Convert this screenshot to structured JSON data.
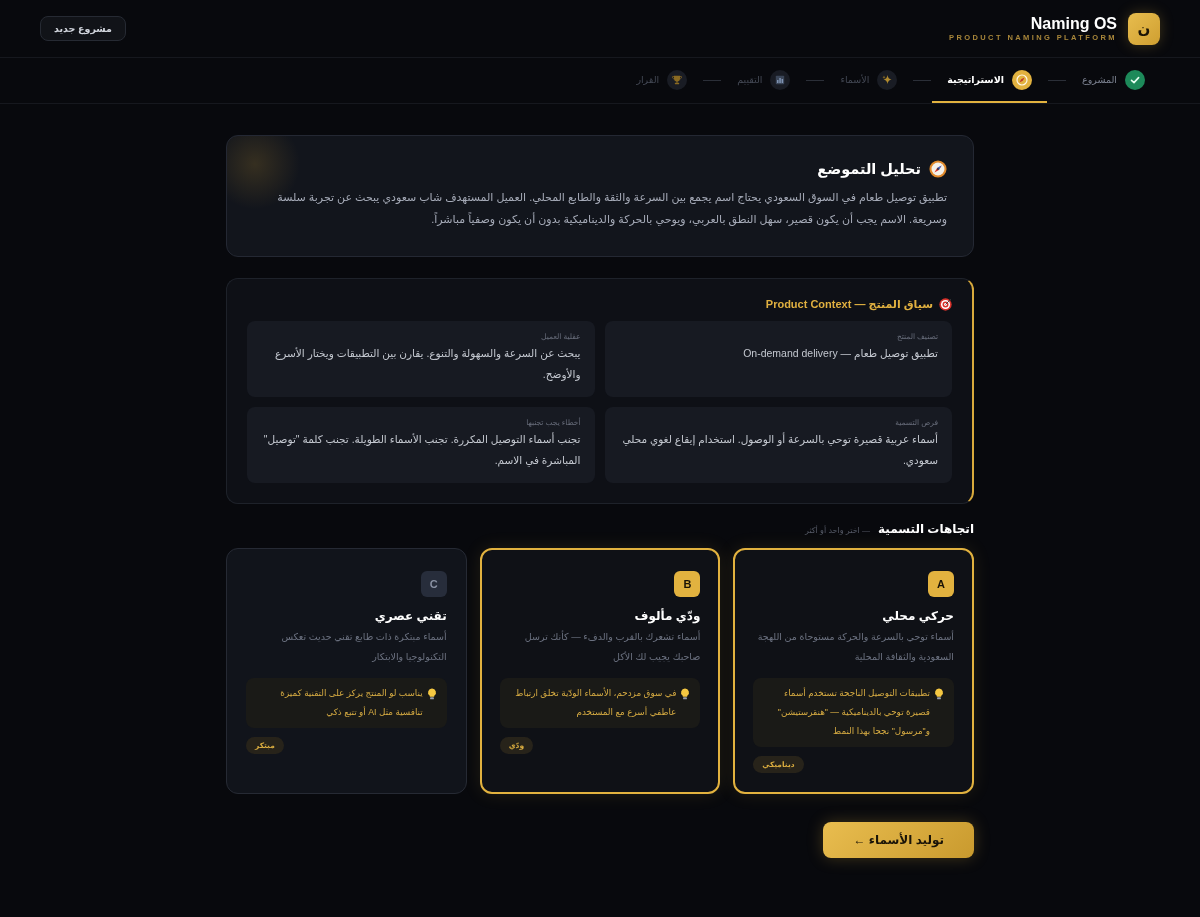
{
  "header": {
    "logo_letter": "ن",
    "title": "Naming OS",
    "subtitle": "PRODUCT NAMING PLATFORM",
    "new_project_button": "مشروع جديد"
  },
  "steps": [
    {
      "label": "المشروع",
      "completed": true,
      "selected": false
    },
    {
      "label": "الاستراتيجية",
      "completed": false,
      "selected": true
    },
    {
      "label": "الأسماء",
      "completed": false,
      "selected": false
    },
    {
      "label": "التقييم",
      "completed": false,
      "selected": false
    },
    {
      "label": "القرار",
      "completed": false,
      "selected": false
    }
  ],
  "positioning": {
    "title": "تحليل التموضع",
    "text": "تطبيق توصيل طعام في السوق السعودي يحتاج اسم يجمع بين السرعة والثقة والطابع المحلي. العميل المستهدف شاب سعودي يبحث عن تجربة سلسة وسريعة. الاسم يجب أن يكون قصير، سهل النطق بالعربي، ويوحي بالحركة والديناميكية بدون أن يكون وصفياً مباشراً."
  },
  "product_context": {
    "title": "سياق المنتج — Product Context",
    "fields": [
      {
        "label": "تصنيف المنتج",
        "value": "تطبيق توصيل طعام — On-demand delivery"
      },
      {
        "label": "عقلية العميل",
        "value": "يبحث عن السرعة والسهولة والتنوع. يقارن بين التطبيقات ويختار الأسرع والأوضح."
      },
      {
        "label": "فرص التسمية",
        "value": "أسماء عربية قصيرة توحي بالسرعة أو الوصول. استخدام إيقاع لغوي محلي سعودي."
      },
      {
        "label": "أخطاء يجب تجنبها",
        "value": "تجنب أسماء التوصيل المكررة. تجنب الأسماء الطويلة. تجنب كلمة \"توصيل\" المباشرة في الاسم."
      }
    ]
  },
  "directions": {
    "title": "اتجاهات التسمية",
    "hint": "— اختر واحد أو أكثر",
    "items": [
      {
        "letter": "A",
        "title": "حركي محلي",
        "description": "أسماء توحي بالسرعة والحركة مستوحاة من اللهجة السعودية والثقافة المحلية",
        "tip": "تطبيقات التوصيل الناجحة تستخدم أسماء قصيرة توحي بالديناميكية — \"هنقرستيشن\" و\"مرسول\" نجحا بهذا النمط",
        "tag": "ديناميكي",
        "selected": true
      },
      {
        "letter": "B",
        "title": "ودّي مألوف",
        "description": "أسماء تشعرك بالقرب والدفء — كأنك ترسل صاحبك يجيب لك الأكل",
        "tip": "في سوق مزدحم، الأسماء الودّية تخلق ارتباط عاطفي أسرع مع المستخدم",
        "tag": "ودّي",
        "selected": true
      },
      {
        "letter": "C",
        "title": "تقني عصري",
        "description": "أسماء مبتكرة ذات طابع تقني حديث تعكس التكنولوجيا والابتكار",
        "tip": "يناسب لو المنتج يركز على التقنية كميزة تنافسية مثل AI أو تتبع ذكي",
        "tag": "مبتكر",
        "selected": false
      }
    ]
  },
  "generate_button": "توليد الأسماء ←"
}
